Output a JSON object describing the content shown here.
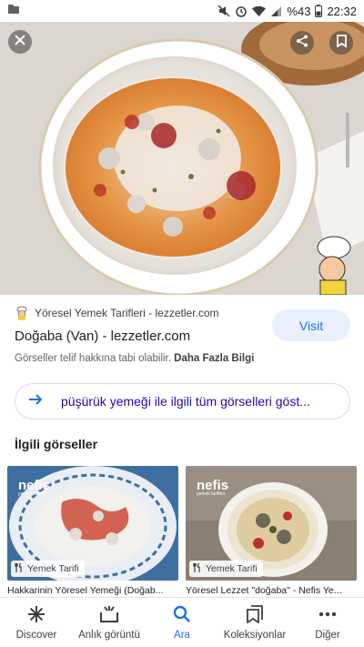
{
  "status_bar": {
    "battery": "%43",
    "time": "22:32",
    "icons": [
      "notification-icon",
      "mute-icon",
      "alarm-icon",
      "wifi-icon",
      "signal-icon",
      "battery-icon"
    ]
  },
  "hero": {
    "icons": [
      "close-icon",
      "share-icon",
      "bookmark-icon"
    ]
  },
  "result": {
    "source": "Yöresel Yemek Tarifleri - lezzetler.com",
    "title": "Doğaba (Van) - lezzetler.com",
    "visit_label": "Visit",
    "copyright_text": "Görseller telif hakkına tabi olabilir.",
    "more_info": "Daha Fazla Bilgi"
  },
  "see_all": {
    "label": "püşürük yemeği ile ilgili tüm görselleri göst..."
  },
  "related": {
    "heading": "İlgili görseller",
    "items": [
      {
        "badge": "Yemek Tarifi",
        "caption": "Hakkarinin Yöresel Yemeği (Doğab..."
      },
      {
        "badge": "Yemek Tarifi",
        "caption": "Yöresel Lezzet \"doğaba\" - Nefis Ye..."
      }
    ],
    "watermark": "nefis",
    "watermark_sub": "yemek tarifleri"
  },
  "bottom_nav": {
    "items": [
      {
        "label": "Discover",
        "icon": "asterisk-icon"
      },
      {
        "label": "Anlık görüntü",
        "icon": "snapshot-icon"
      },
      {
        "label": "Ara",
        "icon": "search-icon"
      },
      {
        "label": "Koleksiyonlar",
        "icon": "collections-icon"
      },
      {
        "label": "Diğer",
        "icon": "more-icon"
      }
    ],
    "active": "Ara"
  },
  "colors": {
    "accent": "#1a73e8",
    "link": "#1a0dab",
    "visit_bg": "#e8f0fe"
  }
}
